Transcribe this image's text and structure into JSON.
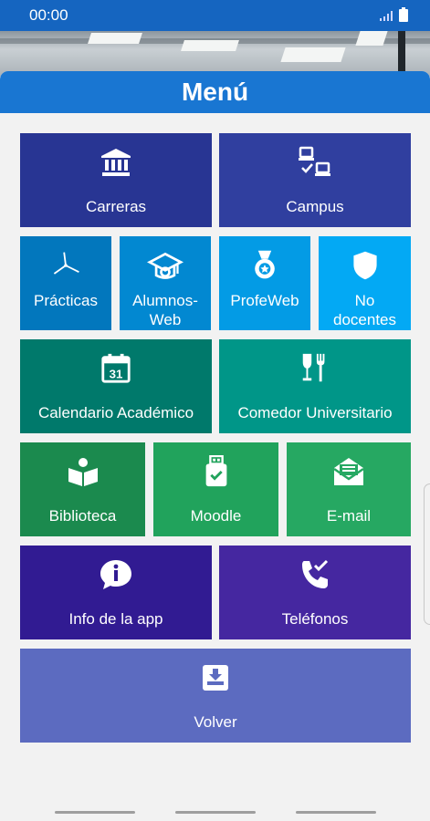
{
  "status_bar": {
    "time": "00:00"
  },
  "header": {
    "title": "Menú"
  },
  "tiles": [
    {
      "label": "Carreras",
      "icon": "bank-icon",
      "color": "#283593"
    },
    {
      "label": "Campus",
      "icon": "computers-check-icon",
      "color": "#303f9f"
    },
    {
      "label": "Prácticas",
      "icon": "wind-turbine-icon",
      "color": "#0277bd"
    },
    {
      "label": "Alumnos-Web",
      "icon": "graduation-cap-icon",
      "color": "#0288d1"
    },
    {
      "label": "ProfeWeb",
      "icon": "medal-icon",
      "color": "#039be5"
    },
    {
      "label": "No docentes",
      "icon": "shield-icon",
      "color": "#03a9f4"
    },
    {
      "label": "Calendario Académico",
      "icon": "calendar-icon",
      "color": "#00796b"
    },
    {
      "label": "Comedor Universitario",
      "icon": "utensils-icon",
      "color": "#009688"
    },
    {
      "label": "Biblioteca",
      "icon": "book-reader-icon",
      "color": "#1b8a4e"
    },
    {
      "label": "Moodle",
      "icon": "usb-check-icon",
      "color": "#21a35c"
    },
    {
      "label": "E-mail",
      "icon": "envelope-open-icon",
      "color": "#26a862"
    },
    {
      "label": "Info de la app",
      "icon": "info-bubble-icon",
      "color": "#311b92"
    },
    {
      "label": "Teléfonos",
      "icon": "phone-check-icon",
      "color": "#4527a0"
    },
    {
      "label": "Volver",
      "icon": "download-box-icon",
      "color": "#5c6bc0"
    }
  ]
}
